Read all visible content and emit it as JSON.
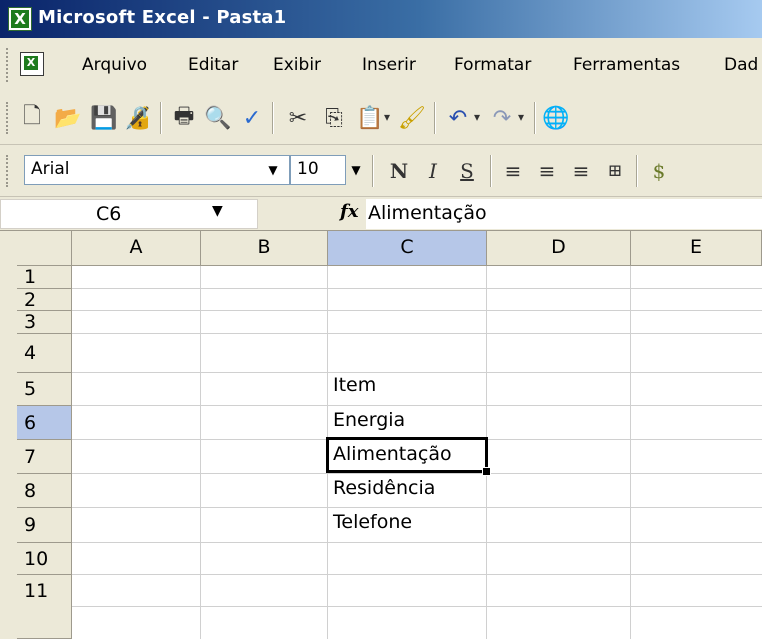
{
  "window": {
    "title": "Microsoft Excel - Pasta1"
  },
  "menu": {
    "items": [
      "Arquivo",
      "Editar",
      "Exibir",
      "Inserir",
      "Formatar",
      "Ferramentas",
      "Dad"
    ]
  },
  "formatting": {
    "font": "Arial",
    "size": "10",
    "bold": "N",
    "italic": "I",
    "underline": "S"
  },
  "formula_bar": {
    "cell_ref": "C6",
    "fx": "fx",
    "content": "Alimentação"
  },
  "sheet": {
    "columns": [
      "A",
      "B",
      "C",
      "D",
      "E"
    ],
    "rows": [
      "1",
      "2",
      "3",
      "4",
      "5",
      "6",
      "7",
      "8",
      "9",
      "10",
      "11"
    ],
    "active_column": "C",
    "active_row": "6",
    "cells": {
      "C4": "Item",
      "C5": "Energia",
      "C6": "Alimentação",
      "C7": "Residência",
      "C8": "Telefone"
    }
  },
  "colors": {
    "title_start": "#0a246a",
    "header_active": "#b6c7e8"
  }
}
